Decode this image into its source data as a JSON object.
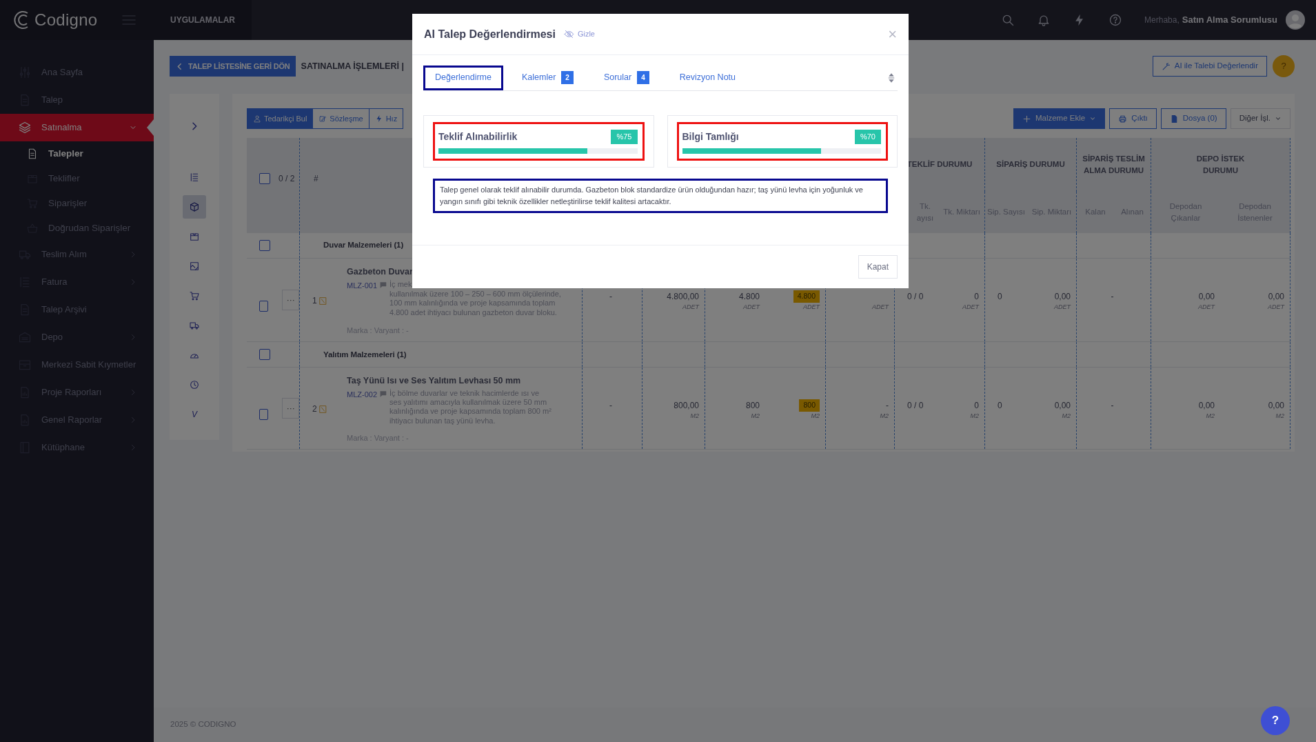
{
  "header": {
    "brand": "Codigno",
    "apps_label": "UYGULAMALAR",
    "greeting": "Merhaba,",
    "user_name": "Satın Alma Sorumlusu"
  },
  "sidebar": {
    "items": [
      {
        "label": "Ana Sayfa",
        "selected": false
      },
      {
        "label": "Talep",
        "selected": false
      },
      {
        "label": "Satınalma",
        "selected": true,
        "expanded": true,
        "children": [
          {
            "label": "Talepler",
            "selected": true
          },
          {
            "label": "Teklifler",
            "selected": false
          },
          {
            "label": "Siparişler",
            "selected": false
          },
          {
            "label": "Doğrudan Siparişler",
            "selected": false
          }
        ]
      },
      {
        "label": "Teslim Alım",
        "selected": false,
        "expanded": false
      },
      {
        "label": "Fatura",
        "selected": false,
        "expanded": false
      },
      {
        "label": "Talep Arşivi",
        "selected": false
      },
      {
        "label": "Depo",
        "selected": false,
        "expanded": false
      },
      {
        "label": "Merkezi Sabit Kıymetler",
        "selected": false
      },
      {
        "label": "Proje Raporları",
        "selected": false,
        "expanded": false
      },
      {
        "label": "Genel Raporlar",
        "selected": false,
        "expanded": false
      },
      {
        "label": "Kütüphane",
        "selected": false,
        "expanded": false
      }
    ]
  },
  "page": {
    "back_button": "TALEP LİSTESİNE GERİ DÖN",
    "title": "SATINALMA İŞLEMLERİ |",
    "ai_button": "AI ile Talebi Değerlendir",
    "help_button": "?"
  },
  "rail": {
    "items": [
      {
        "selected": false
      },
      {
        "selected": true
      },
      {
        "selected": false
      },
      {
        "selected": false
      },
      {
        "selected": false
      },
      {
        "selected": false
      },
      {
        "selected": false
      },
      {
        "selected": false
      },
      {
        "label": "V",
        "selected": false
      }
    ]
  },
  "toolbar": {
    "tabs": [
      {
        "label": "Tedarikçi Bul",
        "selected": true
      },
      {
        "label": "Sözleşme",
        "selected": false
      },
      {
        "label": "Hız",
        "selected": false
      }
    ],
    "buttons": [
      {
        "label": "Malzeme Ekle",
        "kind": "primary"
      },
      {
        "label": "Çıktı",
        "kind": "print"
      },
      {
        "label": "Dosya (0)",
        "kind": "file"
      },
      {
        "label": "Diğer İşl.",
        "kind": "dropdown"
      }
    ]
  },
  "table": {
    "select_count": "0 / 2",
    "number_header": "#",
    "all_checked": false,
    "group_headers": [
      {
        "label": "TEKLİF DURUMU",
        "sub": [
          "Tk. ayısı",
          "Tk. Miktarı"
        ]
      },
      {
        "label": "SİPARİŞ DURUMU",
        "sub": [
          "Sip. Sayısı",
          "Sip. Miktarı"
        ]
      },
      {
        "label": "SİPARİŞ TESLİM ALMA DURUMU",
        "sub": [
          "Kalan",
          "Alınan"
        ]
      },
      {
        "label": "DEPO İSTEK DURUMU",
        "sub": [
          "Depodan Çıkanlar",
          "Depodan İstenenler"
        ]
      }
    ],
    "rows": [
      {
        "kind": "group",
        "label": "Duvar Malzemeleri (1)",
        "checked": false
      },
      {
        "kind": "item",
        "checked": false,
        "more": "···",
        "number": "1",
        "title": "Gazbeton Duvar",
        "code": "MLZ-001",
        "description_lines": [
          "İç mek",
          "kullanılmak üzere 100 – 250 – 600 mm ölçülerinde,",
          "100 mm kalınlığında ve proje kapsamında toplam",
          "4.800 adet ihtiyacı bulunan gazbeton duvar bloku."
        ],
        "meta": "Marka : Varyant : -",
        "cells": [
          {
            "kind": "plain",
            "value": "-"
          },
          {
            "kind": "plain",
            "value": "4.800,00",
            "unit": "ADET"
          },
          {
            "kind": "plain",
            "value": "4.800",
            "unit": "ADET"
          },
          {
            "kind": "badge",
            "value": "4.800",
            "unit": "ADET"
          },
          {
            "kind": "plain",
            "unit": "ADET"
          },
          {
            "kind": "plain",
            "value": "0 / 0"
          },
          {
            "kind": "plain",
            "value": "0",
            "unit": "ADET"
          },
          {
            "kind": "plain",
            "value": "0"
          },
          {
            "kind": "plain",
            "value": "0,00",
            "unit": "ADET"
          },
          {
            "kind": "wide",
            "value": "-"
          },
          {
            "kind": "plain",
            "value": "0,00",
            "unit": "ADET"
          },
          {
            "kind": "plain",
            "value": "0,00",
            "unit": "ADET"
          }
        ]
      },
      {
        "kind": "group",
        "label": "Yalıtım Malzemeleri (1)",
        "checked": false
      },
      {
        "kind": "item",
        "checked": false,
        "more": "···",
        "number": "2",
        "title": "Taş Yünü Isı ve Ses Yalıtım Levhası 50 mm",
        "code": "MLZ-002",
        "description_lines": [
          "İç bölme duvarlar ve teknik hacimlerde ısı ve",
          "ses yalıtımı amacıyla kullanılmak üzere 50 mm",
          "kalınlığında ve proje kapsamında toplam 800 m²",
          "ihtiyacı bulunan taş yünü levha."
        ],
        "meta": "Marka : Varyant : -",
        "cells": [
          {
            "kind": "plain",
            "value": "-"
          },
          {
            "kind": "plain",
            "value": "800,00",
            "unit": "M2"
          },
          {
            "kind": "plain",
            "value": "800",
            "unit": "M2"
          },
          {
            "kind": "badge",
            "value": "800",
            "unit": "M2"
          },
          {
            "kind": "plain",
            "value": "-",
            "unit": "M2"
          },
          {
            "kind": "plain",
            "value": "0 / 0"
          },
          {
            "kind": "plain",
            "value": "0",
            "unit": "M2"
          },
          {
            "kind": "plain",
            "value": "0"
          },
          {
            "kind": "plain",
            "value": "0,00",
            "unit": "M2"
          },
          {
            "kind": "wide",
            "value": "-"
          },
          {
            "kind": "plain",
            "value": "0,00",
            "unit": "M2"
          },
          {
            "kind": "plain",
            "value": "0,00",
            "unit": "M2"
          }
        ]
      }
    ]
  },
  "footer": {
    "copyright": "2025 © CODIGNO",
    "help_button": "?"
  },
  "modal": {
    "title": "AI Talep Değerlendirmesi",
    "hide_label": "Gizle",
    "close": "×",
    "tabs": [
      {
        "label": "Değerlendirme",
        "selected": true
      },
      {
        "label": "Kalemler",
        "count": "2",
        "selected": false
      },
      {
        "label": "Sorular",
        "count": "4",
        "selected": false
      },
      {
        "label": "Revizyon Notu",
        "selected": false
      }
    ],
    "scores": [
      {
        "label": "Teklif Alınabilirlik",
        "value": "%75",
        "level": 0.75
      },
      {
        "label": "Bilgi Tamlığı",
        "value": "%70",
        "level": 0.7
      }
    ],
    "summary": "Talep genel olarak teklif alınabilir durumda. Gazbeton blok standardize ürün olduğundan hazır; taş yünü levha için yoğunluk ve yangın sınıfı gibi teknik özellikler netleştirilirse teklif kalitesi artacaktır.",
    "close_button": "Kapat"
  }
}
